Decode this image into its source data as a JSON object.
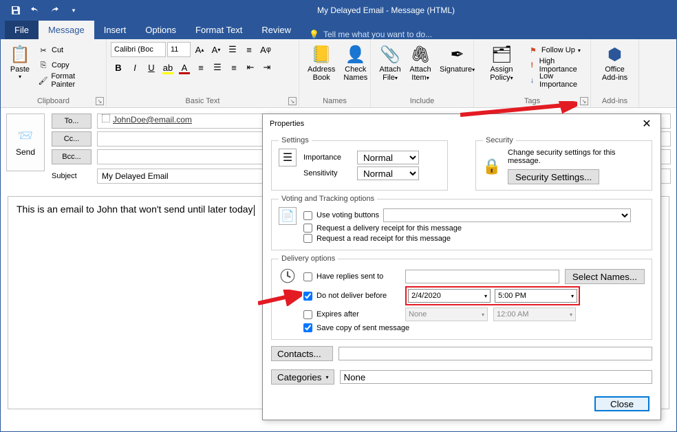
{
  "window": {
    "title": "My Delayed Email  - Message (HTML)"
  },
  "qat": {
    "save": "Save",
    "undo": "Undo",
    "redo": "Redo"
  },
  "tabs": {
    "file": "File",
    "message": "Message",
    "insert": "Insert",
    "options": "Options",
    "format_text": "Format Text",
    "review": "Review",
    "tellme": "Tell me what you want to do..."
  },
  "ribbon": {
    "clipboard": {
      "label": "Clipboard",
      "paste": "Paste",
      "cut": "Cut",
      "copy": "Copy",
      "format_painter": "Format Painter"
    },
    "basic_text": {
      "label": "Basic Text",
      "font_name": "Calibri (Boc",
      "font_size": "11"
    },
    "names": {
      "label": "Names",
      "address_book": "Address Book",
      "check_names": "Check Names"
    },
    "include": {
      "label": "Include",
      "attach_file": "Attach File",
      "attach_item": "Attach Item",
      "signature": "Signature"
    },
    "tags": {
      "label": "Tags",
      "assign_policy": "Assign Policy",
      "follow_up": "Follow Up",
      "high_importance": "High Importance",
      "low_importance": "Low Importance"
    },
    "addins": {
      "label": "Add-ins",
      "office_addins": "Office Add-ins"
    }
  },
  "compose": {
    "send": "Send",
    "to_btn": "To...",
    "cc_btn": "Cc...",
    "bcc_btn": "Bcc...",
    "subject_lbl": "Subject",
    "to_value": "JohnDoe@email.com",
    "cc_value": "",
    "bcc_value": "",
    "subject_value": "My Delayed Email",
    "body_text": "This is an email to John that won't send until later today"
  },
  "dialog": {
    "title": "Properties",
    "settings_legend": "Settings",
    "security_legend": "Security",
    "security_text": "Change security settings for this message.",
    "security_button": "Security Settings...",
    "importance_lbl": "Importance",
    "importance_value": "Normal",
    "sensitivity_lbl": "Sensitivity",
    "sensitivity_value": "Normal",
    "voting_legend": "Voting and Tracking options",
    "use_voting": "Use voting buttons",
    "delivery_receipt": "Request a delivery receipt for this message",
    "read_receipt": "Request a read receipt for this message",
    "delivery_legend": "Delivery options",
    "have_replies": "Have replies sent to",
    "select_names": "Select Names...",
    "do_not_deliver": "Do not deliver before",
    "deliver_date": "2/4/2020",
    "deliver_time": "5:00 PM",
    "expires_after": "Expires after",
    "expires_date": "None",
    "expires_time": "12:00 AM",
    "save_copy": "Save copy of sent message",
    "contacts_btn": "Contacts...",
    "categories_btn": "Categories",
    "categories_value": "None",
    "close_btn": "Close"
  }
}
